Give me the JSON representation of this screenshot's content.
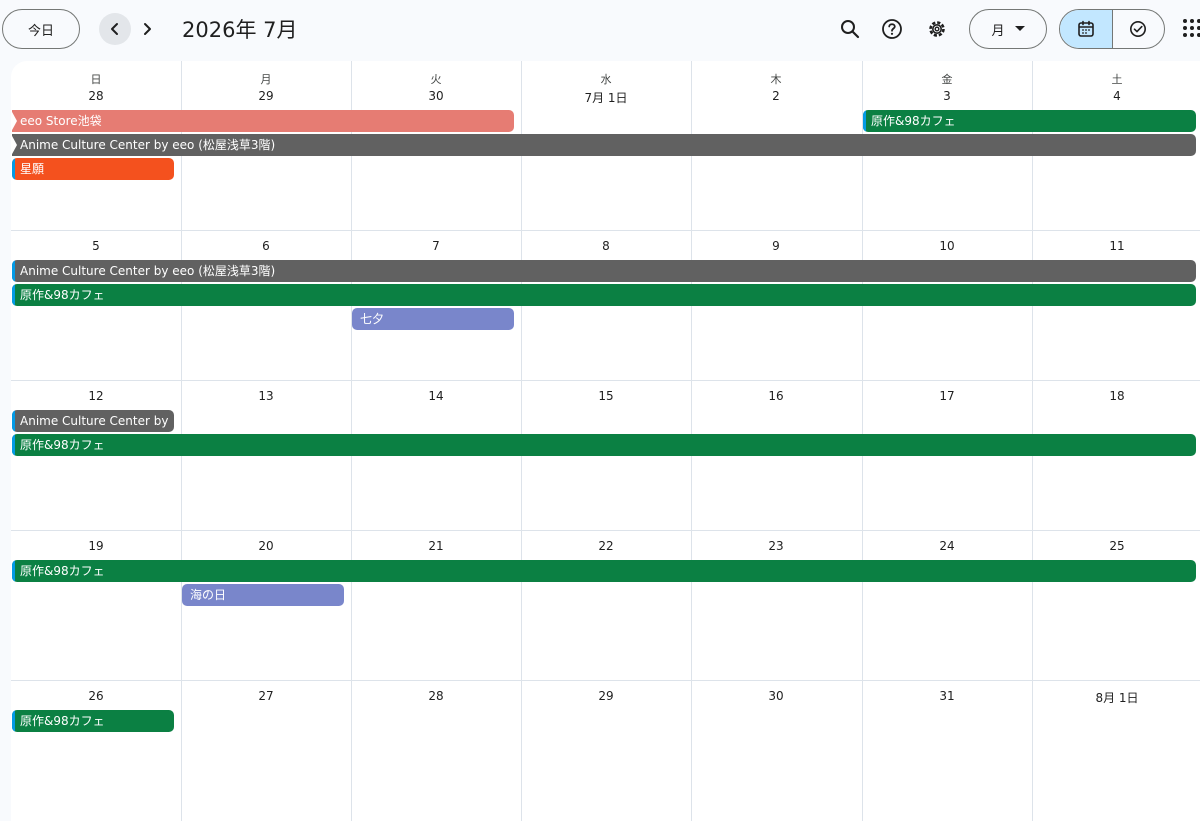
{
  "header": {
    "today_label": "今日",
    "title": "2026年 7月",
    "view_label": "月"
  },
  "colors": {
    "flamingo": "#e67c73",
    "graphite": "#616161",
    "tangerine": "#f4511e",
    "basil": "#0b8043",
    "lavender": "#7986cb",
    "accent": "#c2e7ff"
  },
  "weekdays": [
    "日",
    "月",
    "火",
    "水",
    "木",
    "金",
    "土"
  ],
  "weeks": [
    {
      "days": [
        "28",
        "29",
        "30",
        "7月 1日",
        "2",
        "3",
        "4"
      ],
      "events": [
        {
          "title": "eeo Store池袋",
          "start": 0,
          "span": 3,
          "row": 0,
          "color": "#e67c73",
          "arrow": true
        },
        {
          "title": "原作&98カフェ",
          "start": 5,
          "span": 2,
          "row": 0,
          "color": "#0b8043",
          "stripe": true
        },
        {
          "title": "Anime Culture Center by eeo (松屋浅草3階)",
          "start": 0,
          "span": 7,
          "row": 1,
          "color": "#616161",
          "arrow": true
        },
        {
          "title": "星願",
          "start": 0,
          "span": 1,
          "row": 2,
          "color": "#f4511e",
          "stripe": true
        }
      ]
    },
    {
      "days": [
        "5",
        "6",
        "7",
        "8",
        "9",
        "10",
        "11"
      ],
      "events": [
        {
          "title": "Anime Culture Center by eeo (松屋浅草3階)",
          "start": 0,
          "span": 7,
          "row": 0,
          "color": "#616161",
          "stripe": true
        },
        {
          "title": "原作&98カフェ",
          "start": 0,
          "span": 7,
          "row": 1,
          "color": "#0b8043",
          "stripe": true
        },
        {
          "title": "七夕",
          "start": 2,
          "span": 1,
          "row": 2,
          "color": "#7986cb"
        }
      ]
    },
    {
      "days": [
        "12",
        "13",
        "14",
        "15",
        "16",
        "17",
        "18"
      ],
      "events": [
        {
          "title": "Anime Culture Center by",
          "start": 0,
          "span": 1,
          "row": 0,
          "color": "#616161",
          "stripe": true
        },
        {
          "title": "原作&98カフェ",
          "start": 0,
          "span": 7,
          "row": 1,
          "color": "#0b8043",
          "stripe": true
        }
      ]
    },
    {
      "days": [
        "19",
        "20",
        "21",
        "22",
        "23",
        "24",
        "25"
      ],
      "events": [
        {
          "title": "原作&98カフェ",
          "start": 0,
          "span": 7,
          "row": 0,
          "color": "#0b8043",
          "stripe": true
        },
        {
          "title": "海の日",
          "start": 1,
          "span": 1,
          "row": 1,
          "color": "#7986cb"
        }
      ]
    },
    {
      "days": [
        "26",
        "27",
        "28",
        "29",
        "30",
        "31",
        "8月 1日"
      ],
      "events": [
        {
          "title": "原作&98カフェ",
          "start": 0,
          "span": 1,
          "row": 0,
          "color": "#0b8043",
          "stripe": true
        }
      ]
    }
  ]
}
